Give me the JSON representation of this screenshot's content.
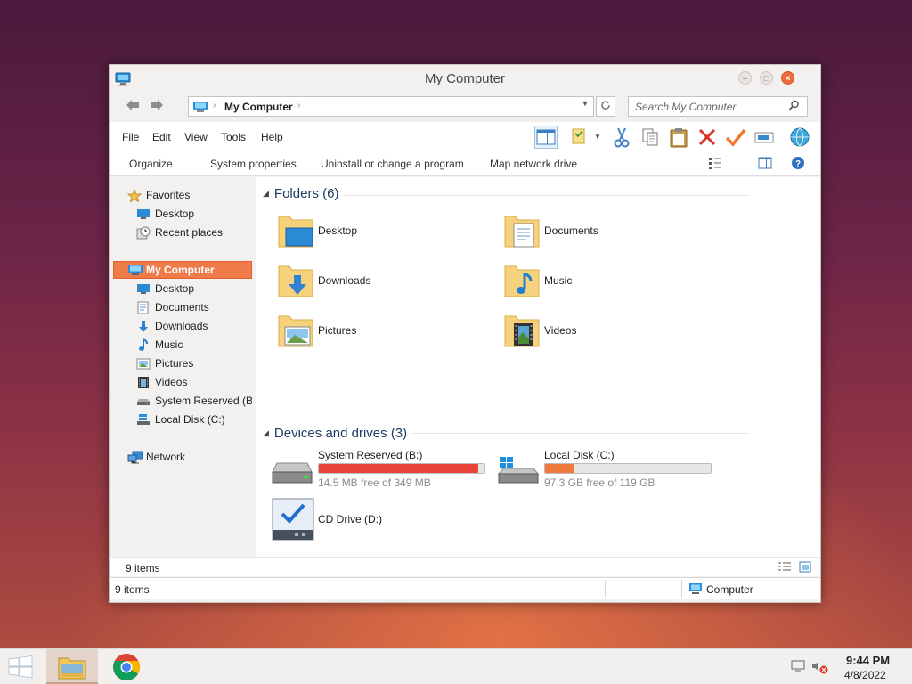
{
  "window": {
    "title": "My Computer",
    "address": {
      "crumb": "My Computer"
    },
    "search": {
      "placeholder": "Search My Computer"
    }
  },
  "menu": [
    "File",
    "Edit",
    "View",
    "Tools",
    "Help"
  ],
  "commands": [
    "Organize",
    "System properties",
    "Uninstall or change a program",
    "Map network drive"
  ],
  "toolbar_icons": [
    "preview-pane-icon",
    "folder-options-icon",
    "cut-icon",
    "copy-icon",
    "paste-icon",
    "delete-icon",
    "properties-check-icon",
    "rename-icon",
    "globe-icon"
  ],
  "nav": {
    "favorites": {
      "label": "Favorites",
      "items": [
        "Desktop",
        "Recent places"
      ]
    },
    "computer": {
      "label": "My Computer",
      "items": [
        "Desktop",
        "Documents",
        "Downloads",
        "Music",
        "Pictures",
        "Videos",
        "System Reserved (B:)",
        "Local Disk (C:)"
      ]
    },
    "network": {
      "label": "Network"
    }
  },
  "content": {
    "folders_header": "Folders (6)",
    "folders": [
      "Desktop",
      "Documents",
      "Downloads",
      "Music",
      "Pictures",
      "Videos"
    ],
    "devices_header": "Devices and drives (3)",
    "drives": [
      {
        "name": "System Reserved (B:)",
        "free": "14.5 MB free of 349 MB",
        "used_fraction": 0.96,
        "color": "#e8443a"
      },
      {
        "name": "Local Disk (C:)",
        "free": "97.3 GB free of 119 GB",
        "used_fraction": 0.18,
        "color": "#f07a3c"
      }
    ],
    "cd": {
      "name": "CD Drive (D:)"
    }
  },
  "details": {
    "count": "9 items"
  },
  "status": {
    "count": "9 items",
    "zone": "Computer"
  },
  "taskbar": {
    "time": "9:44 PM",
    "date": "4/8/2022"
  },
  "colors": {
    "accent": "#ef7a4a",
    "close": "#ef6b3f"
  }
}
